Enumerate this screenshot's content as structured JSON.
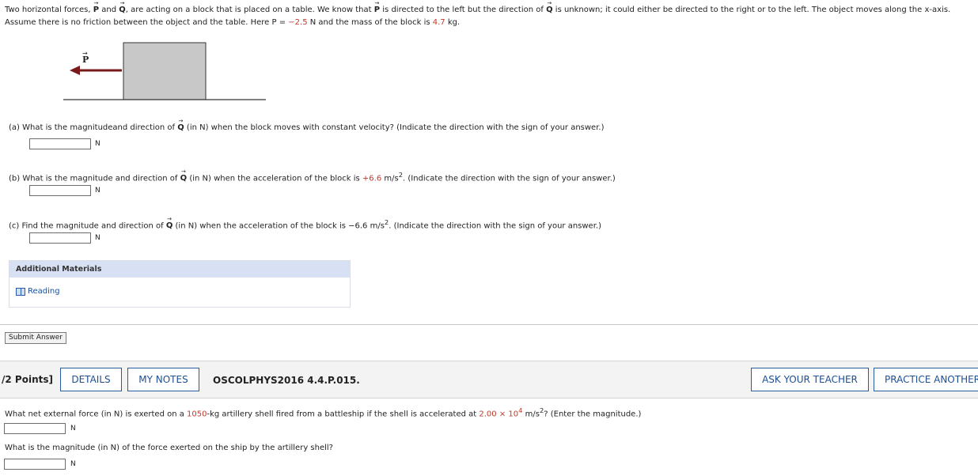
{
  "intro": {
    "t1": "Two horizontal forces, ",
    "vecP": "P",
    "t2": " and ",
    "vecQ": "Q",
    "t3": ", are acting on a block that is placed on a table. We know that ",
    "t4": " is directed to the left but the direction of ",
    "t5": " is unknown; it could either be directed to the right or to the left. The object moves along the x-axis. Assume there is no friction between the object and the table. Here P = ",
    "p_value": "−2.5",
    "t6": " N and the mass of the block is ",
    "mass_value": "4.7",
    "t7": " kg."
  },
  "figure": {
    "force_label": "P",
    "arrow_color": "#7a1a1a",
    "block_color": "#c8c8c8"
  },
  "questions": [
    {
      "pre": "(a)   What is the magnitudeand direction of ",
      "post": " (in N) when the block moves with constant velocity? (Indicate the direction with the sign of your answer.)",
      "unit": "N"
    },
    {
      "pre": "(b)   What is the magnitude and direction of ",
      "mid": " (in N) when the acceleration of the block is ",
      "accel": "+6.6",
      "post": " m/s",
      "sup": "2",
      "tail": ". (Indicate the direction with the sign of your answer.)",
      "unit": "N"
    },
    {
      "pre": "(c)   Find the magnitude and direction of ",
      "mid": " (in N) when the acceleration of the block is ",
      "accel": "−6.6",
      "post": " m/s",
      "sup": "2",
      "tail": ". (Indicate the direction with the sign of your answer.)",
      "unit": "N"
    }
  ],
  "additional": {
    "title": "Additional Materials",
    "reading": "Reading"
  },
  "submit_label": "Submit Answer",
  "toolbar": {
    "points": "/2 Points]",
    "details": "DETAILS",
    "my_notes": "MY NOTES",
    "problem_id": "OSCOLPHYS2016 4.4.P.015.",
    "ask_teacher": "ASK YOUR TEACHER",
    "practice": "PRACTICE ANOTHER"
  },
  "problem2": {
    "q1_pre": "What net external force (in N) is exerted on a ",
    "q1_mass": "1050",
    "q1_mid": "-kg artillery shell fired from a battleship if the shell is accelerated at ",
    "q1_accel": "2.00 × 10",
    "q1_exp": "4",
    "q1_post1": " m/s",
    "q1_post_sup": "2",
    "q1_post2": "? (Enter the magnitude.)",
    "q1_unit": "N",
    "q2": "What is the magnitude (in N) of the force exerted on the ship by the artillery shell?",
    "q2_unit": "N"
  },
  "colors": {
    "accent": "#1d4f91",
    "red_value": "#c0392b",
    "toolbar_bg": "#f3f3f3"
  }
}
